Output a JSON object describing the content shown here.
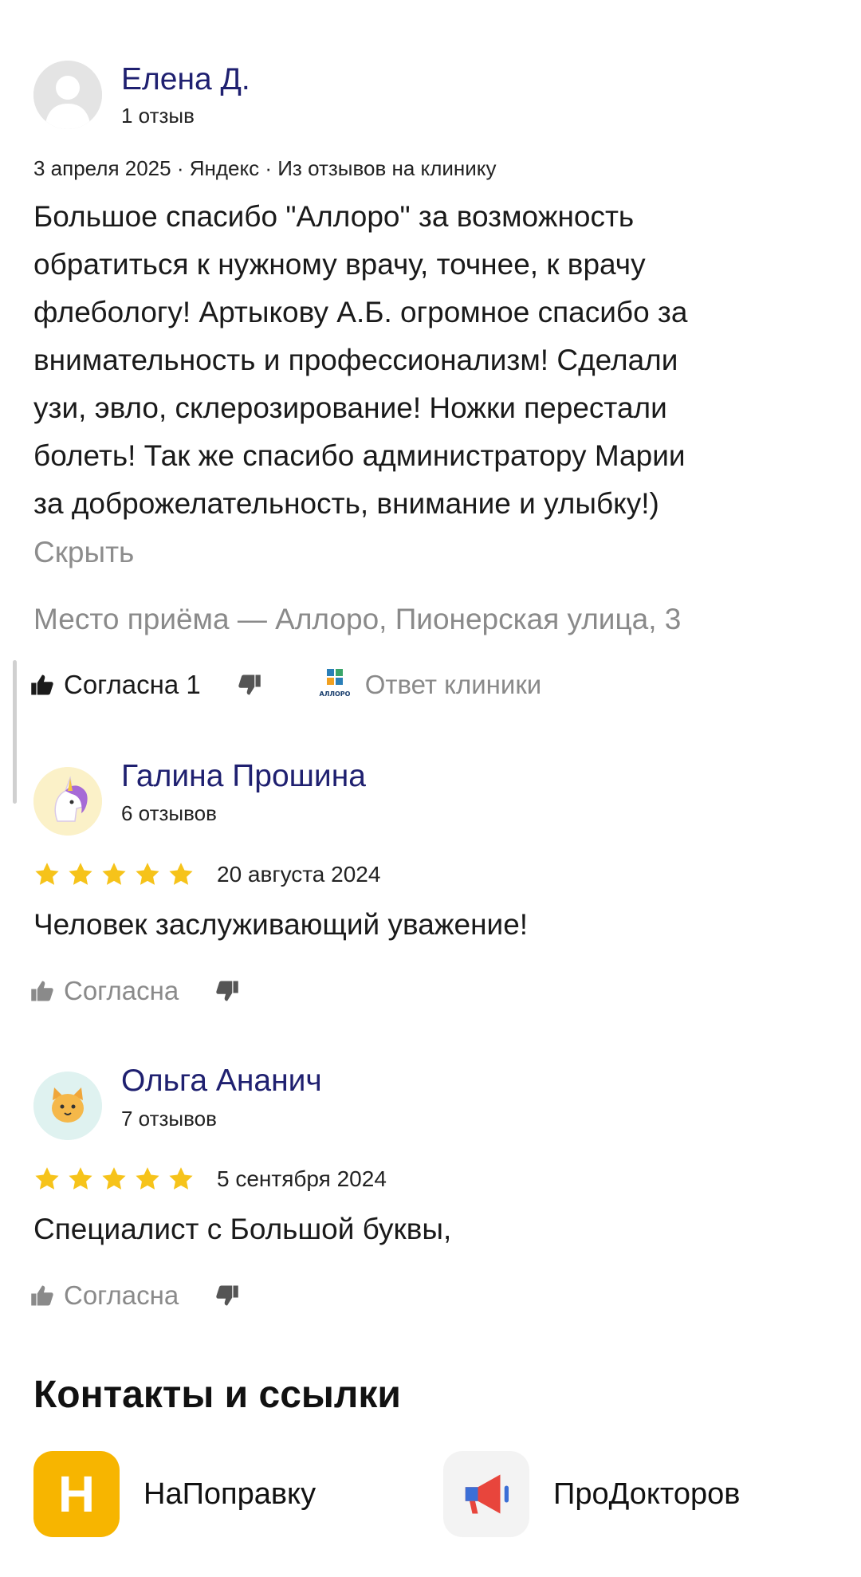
{
  "reviews": [
    {
      "author": "Елена Д.",
      "reviews_count": "1 отзыв",
      "meta": "3 апреля 2025 · Яндекс · Из отзывов на клинику",
      "text_lines": [
        "Большое спасибо \"Аллоро\" за возможность",
        "обратиться к нужному врачу, точнее, к врачу",
        "флебологу! Артыкову А.Б. огромное спасибо за",
        "внимательность и профессионализм! Сделали",
        "узи, эвло, склерозирование! Ножки перестали",
        "болеть! Так же спасибо администратору Марии",
        "за доброжелательность, внимание и улыбку!)"
      ],
      "hide_label": "Скрыть",
      "place": "Место приёма — Аллоро, Пионерская улица, 3",
      "like_label": "Согласна 1",
      "clinic_logo_text": "АЛЛОРО",
      "reply_label": "Ответ клиники"
    },
    {
      "author": "Галина Прошина",
      "reviews_count": "6 отзывов",
      "rating": 5,
      "date": "20 августа 2024",
      "text": "Человек заслуживающий уважение!",
      "like_label": "Согласна"
    },
    {
      "author": "Ольга Ананич",
      "reviews_count": "7 отзывов",
      "rating": 5,
      "date": "5 сентября 2024",
      "text": "Специалист с Большой буквы,",
      "like_label": "Согласна"
    }
  ],
  "contacts": {
    "title": "Контакты и ссылки",
    "items": [
      {
        "label": "НаПоправку",
        "icon": "napopravku-logo-icon",
        "icon_letter": "Н",
        "color": "#f7b500"
      },
      {
        "label": "ПроДокторов",
        "icon": "prodoktorov-megaphone-icon",
        "color": "#e8453c"
      }
    ]
  },
  "colors": {
    "star": "#f6c31a",
    "author": "#1f2070",
    "muted": "#8a8a8a"
  }
}
